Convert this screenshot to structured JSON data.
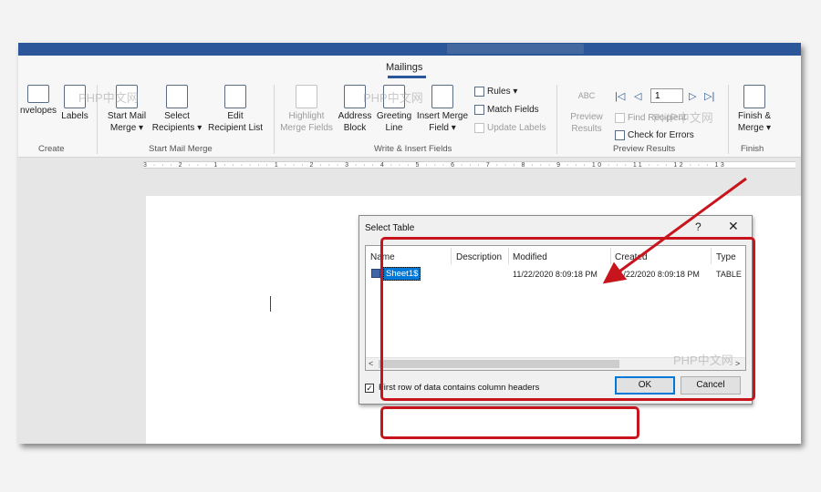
{
  "ribbon": {
    "active_tab": "Mailings",
    "create": {
      "envelopes": "nvelopes",
      "labels": "Labels",
      "group": "Create"
    },
    "start_mail_merge": {
      "start_line1": "Start Mail",
      "start_line2": "Merge",
      "select_line1": "Select",
      "select_line2": "Recipients",
      "edit_line1": "Edit",
      "edit_line2": "Recipient List",
      "group": "Start Mail Merge"
    },
    "write_insert": {
      "highlight_line1": "Highlight",
      "highlight_line2": "Merge Fields",
      "address_line1": "Address",
      "address_line2": "Block",
      "greeting_line1": "Greeting",
      "greeting_line2": "Line",
      "insert_line1": "Insert Merge",
      "insert_line2": "Field",
      "rules": "Rules",
      "match": "Match Fields",
      "update": "Update Labels",
      "group": "Write & Insert Fields"
    },
    "preview": {
      "abc": "ABC",
      "preview_line1": "Preview",
      "preview_line2": "Results",
      "record_number": "1",
      "find": "Find Recipient",
      "check_errors": "Check for Errors",
      "group": "Preview Results"
    },
    "finish": {
      "finish_line1": "Finish &",
      "finish_line2": "Merge",
      "group": "Finish"
    }
  },
  "ruler": {
    "marks": "3 · · · 2 · · · 1 · · ·   · · · 1 · · · 2 · · · 3 · · · 4 · · · 5 · · · 6 · · · 7 · · · 8 · · · 9 · · · 10 · · · 11 · · · 12 · · · 13"
  },
  "dialog": {
    "title": "Select Table",
    "help": "?",
    "close": "✕",
    "columns": [
      "Name",
      "Description",
      "Modified",
      "Created",
      "Type"
    ],
    "rows": [
      {
        "name": "Sheet1$",
        "description": "",
        "modified": "11/22/2020 8:09:18 PM",
        "created": "11/22/2020 8:09:18 PM",
        "type": "TABLE"
      }
    ],
    "checkbox_checked": true,
    "checkbox_label": "First row of data contains column headers",
    "ok_label": "OK",
    "cancel_label": "Cancel"
  },
  "watermark": "PHP中文网",
  "annotation_color": "#c8151d"
}
